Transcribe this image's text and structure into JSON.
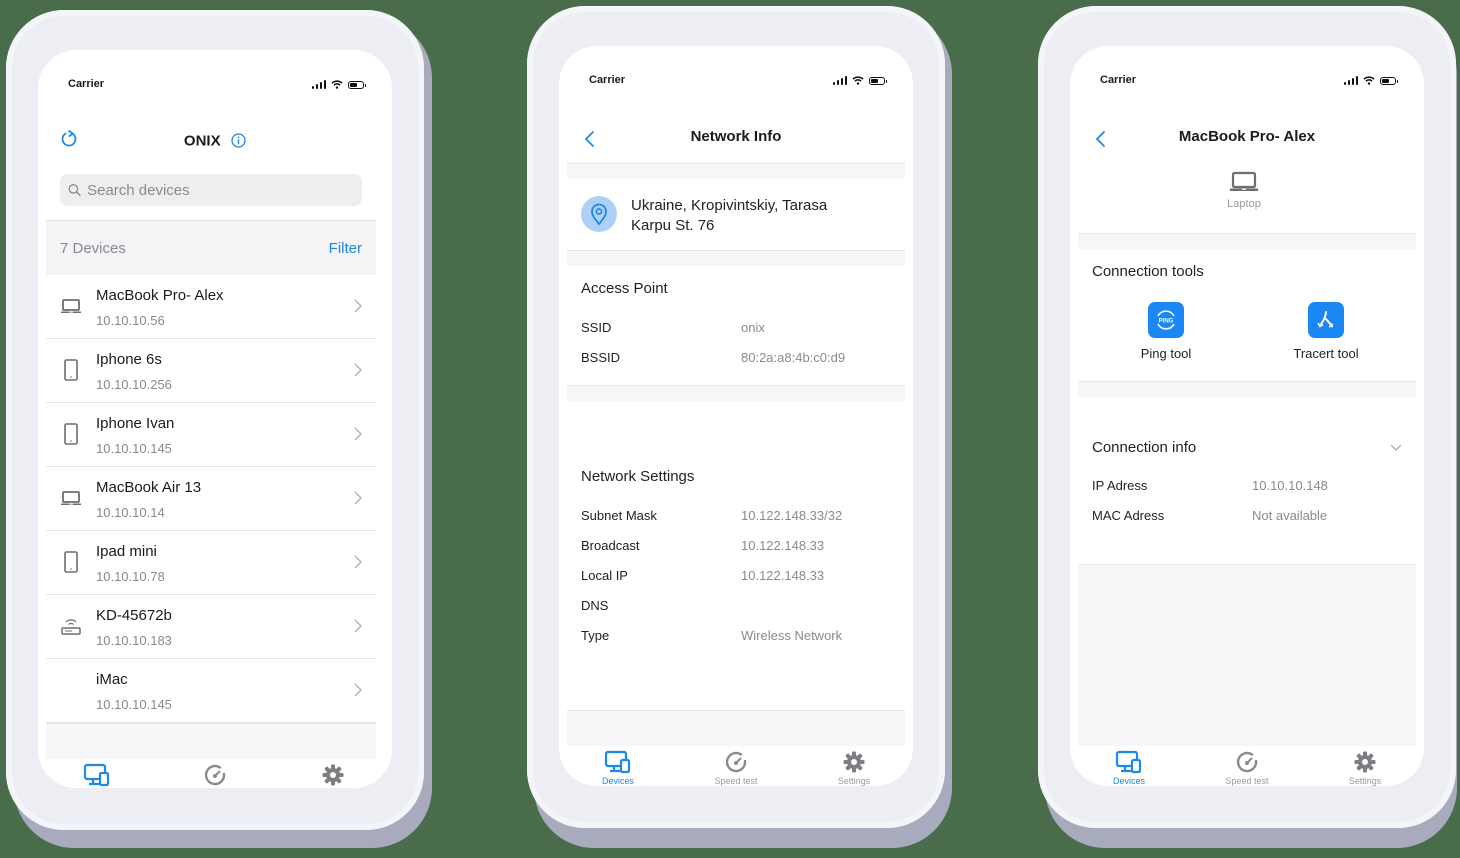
{
  "status_bar": {
    "carrier": "Carrier"
  },
  "tab_bar": {
    "items": [
      {
        "label": "Devices",
        "icon": "devices-icon",
        "active": true
      },
      {
        "label": "Speed test",
        "icon": "speedometer-icon",
        "active": false
      },
      {
        "label": "Settings",
        "icon": "gear-icon",
        "active": false
      }
    ]
  },
  "colors": {
    "accent": "#1e88e5",
    "background": "#496c4a",
    "text": "#1b1b1b",
    "secondary_text": "#8a8a8e"
  },
  "screen1": {
    "title": "ONIX",
    "refresh_icon": "refresh-icon",
    "info_icon": "info-icon",
    "search": {
      "placeholder": "Search devices",
      "value": ""
    },
    "device_count": "7 Devices",
    "filter_label": "Filter",
    "devices": [
      {
        "name": "MacBook Pro- Alex",
        "ip": "10.10.10.56",
        "icon": "laptop-icon"
      },
      {
        "name": "Iphone 6s",
        "ip": "10.10.10.256",
        "icon": "phone-icon"
      },
      {
        "name": "Iphone Ivan",
        "ip": "10.10.10.145",
        "icon": "phone-icon"
      },
      {
        "name": "MacBook Air 13",
        "ip": "10.10.10.14",
        "icon": "laptop-icon"
      },
      {
        "name": "Ipad mini",
        "ip": "10.10.10.78",
        "icon": "tablet-icon"
      },
      {
        "name": "KD-45672b",
        "ip": "10.10.10.183",
        "icon": "router-icon"
      },
      {
        "name": "iMac",
        "ip": "10.10.10.145",
        "icon": ""
      }
    ]
  },
  "screen2": {
    "title": "Network Info",
    "location": {
      "line1": "Ukraine, Kropivintskiy, Tarasa",
      "line2": "Karpu St. 76"
    },
    "access_point": {
      "title": "Access Point",
      "rows": [
        {
          "label": "SSID",
          "value": "onix"
        },
        {
          "label": "BSSID",
          "value": "80:2a:a8:4b:c0:d9"
        }
      ]
    },
    "network_settings": {
      "title": "Network Settings",
      "rows": [
        {
          "label": "Subnet Mask",
          "value": "10.122.148.33/32"
        },
        {
          "label": "Broadcast",
          "value": "10.122.148.33"
        },
        {
          "label": "Local IP",
          "value": "10.122.148.33"
        },
        {
          "label": "DNS",
          "value": ""
        },
        {
          "label": "Type",
          "value": "Wireless Network"
        }
      ]
    }
  },
  "screen3": {
    "title": "MacBook Pro- Alex",
    "device_type": "Laptop",
    "connection_tools": {
      "title": "Connection tools",
      "tools": [
        {
          "label": "Ping tool",
          "icon": "ping-icon",
          "icon_text": "PING"
        },
        {
          "label": "Tracert tool",
          "icon": "tracert-icon"
        }
      ]
    },
    "connection_info": {
      "title": "Connection info",
      "rows": [
        {
          "label": "IP Adress",
          "value": "10.10.10.148"
        },
        {
          "label": "MAC Adress",
          "value": "Not available"
        }
      ]
    }
  }
}
